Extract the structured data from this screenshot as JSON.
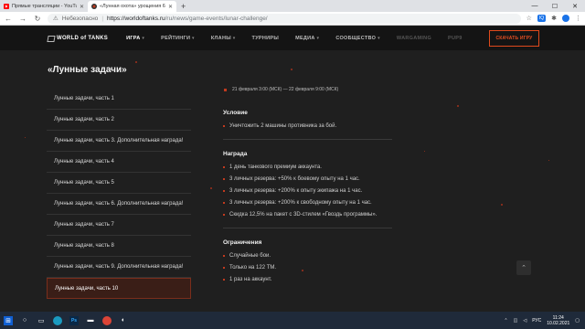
{
  "browser": {
    "tabs": [
      {
        "title": "Прямые трансляции - YouTube",
        "active": false,
        "icon": "youtube-icon"
      },
      {
        "title": "«Лунная охота» урощения 6...",
        "active": true,
        "icon": "wot-icon"
      }
    ],
    "new_tab": "+",
    "security_label": "Небезопасно",
    "url_host": "https://worldoftanks.ru",
    "url_path": "/ru/news/game-events/lunar-challenge/"
  },
  "site": {
    "logo": "WORLD of TANKS",
    "nav": [
      {
        "label": "ИГРА",
        "caret": "▾",
        "active": true
      },
      {
        "label": "РЕЙТИНГИ",
        "caret": "▾",
        "active": false
      },
      {
        "label": "КЛАНЫ",
        "caret": "▾",
        "active": false
      },
      {
        "label": "ТУРНИРЫ",
        "caret": "",
        "active": false
      },
      {
        "label": "МЕДИА",
        "caret": "▾",
        "active": false
      },
      {
        "label": "СООБЩЕСТВО",
        "caret": "▾",
        "active": false
      },
      {
        "label": "WARGAMING",
        "caret": "",
        "active": false,
        "dim": true
      },
      {
        "label": "PUP9",
        "caret": "",
        "active": false,
        "dim": true
      }
    ],
    "download_button": "СКАЧАТЬ ИГРУ"
  },
  "page": {
    "title": "«Лунные задачи»",
    "sidebar": [
      "Лунные задачи, часть 1",
      "Лунные задачи, часть 2",
      "Лунные задачи, часть 3. Дополнительная награда!",
      "Лунные задачи, часть 4",
      "Лунные задачи, часть 5",
      "Лунные задачи, часть 6. Дополнительная награда!",
      "Лунные задачи, часть 7",
      "Лунные задачи, часть 8",
      "Лунные задачи, часть 9. Дополнительная награда!",
      "Лунные задачи, часть 10"
    ],
    "active_index": 9,
    "date": "21 февраля 3:00 (МСК) — 22 февраля 9:00 (МСК)",
    "condition_title": "Условие",
    "condition": [
      "Уничтожить 2 машины противника за бой."
    ],
    "reward_title": "Награда",
    "rewards": [
      "1 день танкового премиум аккаунта.",
      "3 личных резерва: +50% к боевому опыту на 1 час.",
      "3 личных резерва: +200% к опыту экипажа на 1 час.",
      "3 личных резерва: +200% к свободному опыту на 1 час.",
      "Скидка 12,5% на пакет с 3D-стилем «Гвоздь программы»."
    ],
    "limits_title": "Ограничения",
    "limits": [
      "Случайные бои.",
      "Только на 122 ТМ.",
      "1 раз на аккаунт."
    ],
    "scroll_top": "⌃"
  },
  "taskbar": {
    "lang": "РУС",
    "time": "11:24",
    "date": "10.02.2021"
  }
}
